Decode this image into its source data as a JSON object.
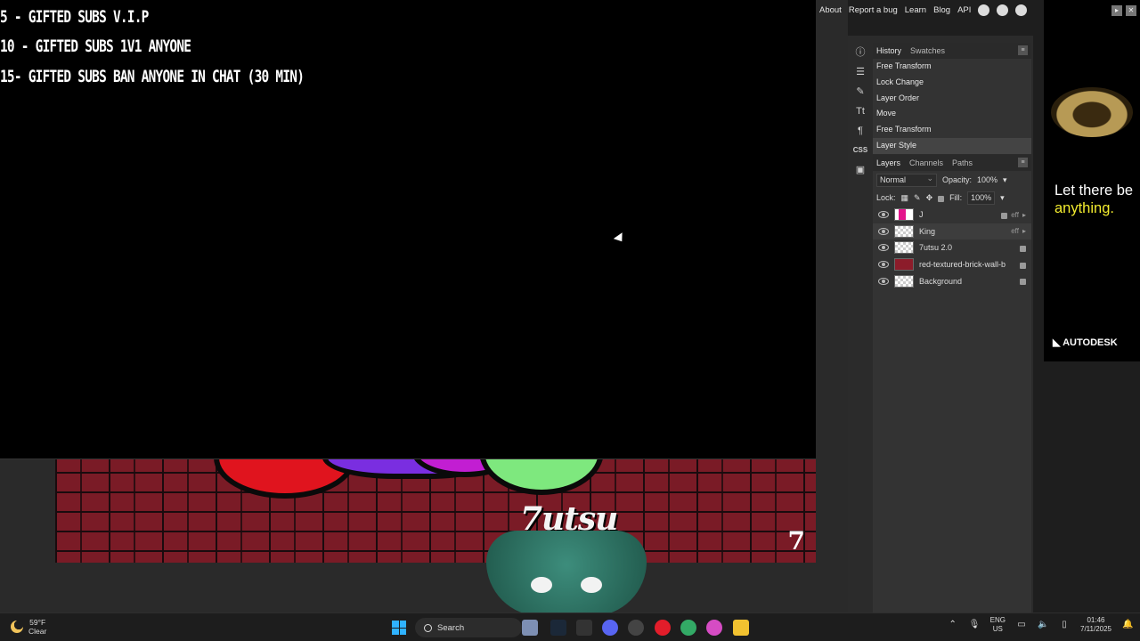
{
  "overlay": {
    "sub_goals": [
      "5 - GIFTED SUBS V.I.P",
      "10 - GIFTED SUBS 1V1 ANYONE",
      "15- GIFTED SUBS BAN ANYONE IN CHAT (30 MIN)"
    ]
  },
  "banner": {
    "logo_text": "7utsu",
    "crest_text": "7"
  },
  "topnav": {
    "items": [
      "About",
      "Report a bug",
      "Learn",
      "Blog",
      "API"
    ],
    "social_icons": [
      "reddit-icon",
      "twitter-icon",
      "facebook-icon"
    ]
  },
  "tools": [
    "info-icon",
    "adjustments-icon",
    "brush-icon",
    "type-icon",
    "paragraph-icon",
    "css-icon",
    "image-icon"
  ],
  "tools_labels": {
    "type": "Tt",
    "paragraph": "¶",
    "css": "CSS"
  },
  "history_panel": {
    "tabs": [
      "History",
      "Swatches"
    ],
    "entries": [
      "Free Transform",
      "Lock Change",
      "Layer Order",
      "Move",
      "Free Transform",
      "Layer Style"
    ]
  },
  "layers_panel": {
    "tabs": [
      "Layers",
      "Channels",
      "Paths"
    ],
    "blend_mode": "Normal",
    "opacity_label": "Opacity:",
    "opacity_value": "100%",
    "lock_label": "Lock:",
    "fill_label": "Fill:",
    "fill_value": "100%",
    "layers": [
      {
        "name": "J",
        "badge": "eff",
        "locked": true
      },
      {
        "name": "King",
        "badge": "eff",
        "locked": false
      },
      {
        "name": "7utsu 2.0",
        "badge": "",
        "locked": true
      },
      {
        "name": "red-textured-brick-wall-b",
        "badge": "",
        "locked": true
      },
      {
        "name": "Background",
        "badge": "",
        "locked": true
      }
    ]
  },
  "ad": {
    "headline_1": "Let there be",
    "headline_2": "anything.",
    "brand": "AUTODESK",
    "accent_color": "#f3ec2e"
  },
  "taskbar": {
    "weather_temp": "59°F",
    "weather_desc": "Clear",
    "search_label": "Search",
    "lang_1": "ENG",
    "lang_2": "US",
    "time": "01:46",
    "date": "7/11/2025"
  }
}
